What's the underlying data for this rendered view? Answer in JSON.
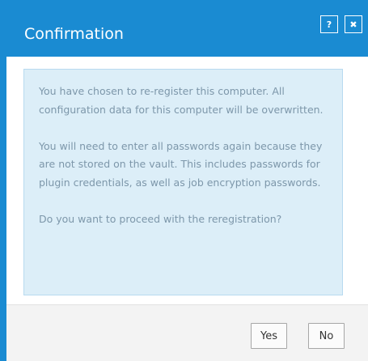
{
  "dialog": {
    "title": "Confirmation",
    "help_label": "?",
    "close_label": "✖"
  },
  "message": {
    "paragraph_1": "You have chosen to re-register this computer. All configuration data for this computer will be overwritten.",
    "paragraph_2": "You will need to enter all passwords again because they are not stored on the vault. This includes passwords for plugin credentials, as well as job encryption passwords.",
    "paragraph_3": "Do you want to proceed with the reregistration?"
  },
  "footer": {
    "yes_label": "Yes",
    "no_label": "No"
  },
  "colors": {
    "accent": "#1a8bd2",
    "info_background": "#dceef8",
    "info_text": "#7d97aa"
  }
}
